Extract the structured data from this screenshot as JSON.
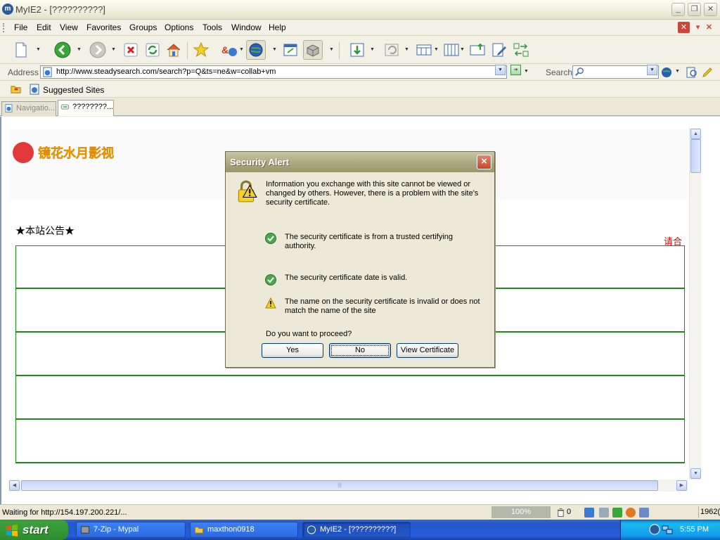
{
  "window": {
    "title": "MyIE2 - [??????????]",
    "app_icon": "m"
  },
  "menu": [
    "File",
    "Edit",
    "View",
    "Favorites",
    "Groups",
    "Options",
    "Tools",
    "Window",
    "Help"
  ],
  "menu_mnemonics": [
    "F",
    "E",
    "V",
    "a",
    "G",
    "O",
    "T",
    "W",
    "H"
  ],
  "address": {
    "label": "Address",
    "url": "http://www.steadysearch.com/search?p=Q&ts=ne&w=collab+vm",
    "search_label": "Search",
    "search_value": ""
  },
  "links_bar": {
    "item": "Suggested Sites"
  },
  "tabs": [
    {
      "label": "Navigatio...",
      "active": false
    },
    {
      "label": "????????...",
      "active": true
    }
  ],
  "page": {
    "logo_text": "镜花水月影视",
    "notice": "★本站公告★",
    "red_link": "请合",
    "row_count": 6
  },
  "dialog": {
    "title": "Security Alert",
    "intro": "Information you exchange with this site cannot be viewed or changed by others. However, there is a problem with the site's security certificate.",
    "checks": [
      {
        "status": "ok",
        "text": "The security certificate is from a trusted certifying authority."
      },
      {
        "status": "ok",
        "text": "The security certificate date is valid."
      },
      {
        "status": "warning",
        "text": "The name on the security certificate is invalid or does not match the name of the site"
      }
    ],
    "question": "Do you want to proceed?",
    "buttons": {
      "yes": "Yes",
      "no": "No",
      "view": "View Certificate"
    },
    "yes_mnemonic": "Y",
    "no_mnemonic": "N",
    "view_mnemonic": "V"
  },
  "status": {
    "text": "Waiting for http://154.197.200.221/...",
    "zoom": "100%",
    "trash_count": "0",
    "right_text": "1962("
  },
  "taskbar": {
    "start": "start",
    "tasks": [
      {
        "label": "7-Zip - Mypal",
        "active": false
      },
      {
        "label": "maxthon0918",
        "active": false
      },
      {
        "label": "MyIE2 - [??????????]",
        "active": true
      }
    ],
    "clock": "5:55 PM"
  },
  "colors": {
    "table_border": "#1a8c1a",
    "dialog_title": "#a8a47c",
    "taskbar": "#245dda",
    "start_green": "#379c37",
    "red_link": "#cc0000"
  }
}
